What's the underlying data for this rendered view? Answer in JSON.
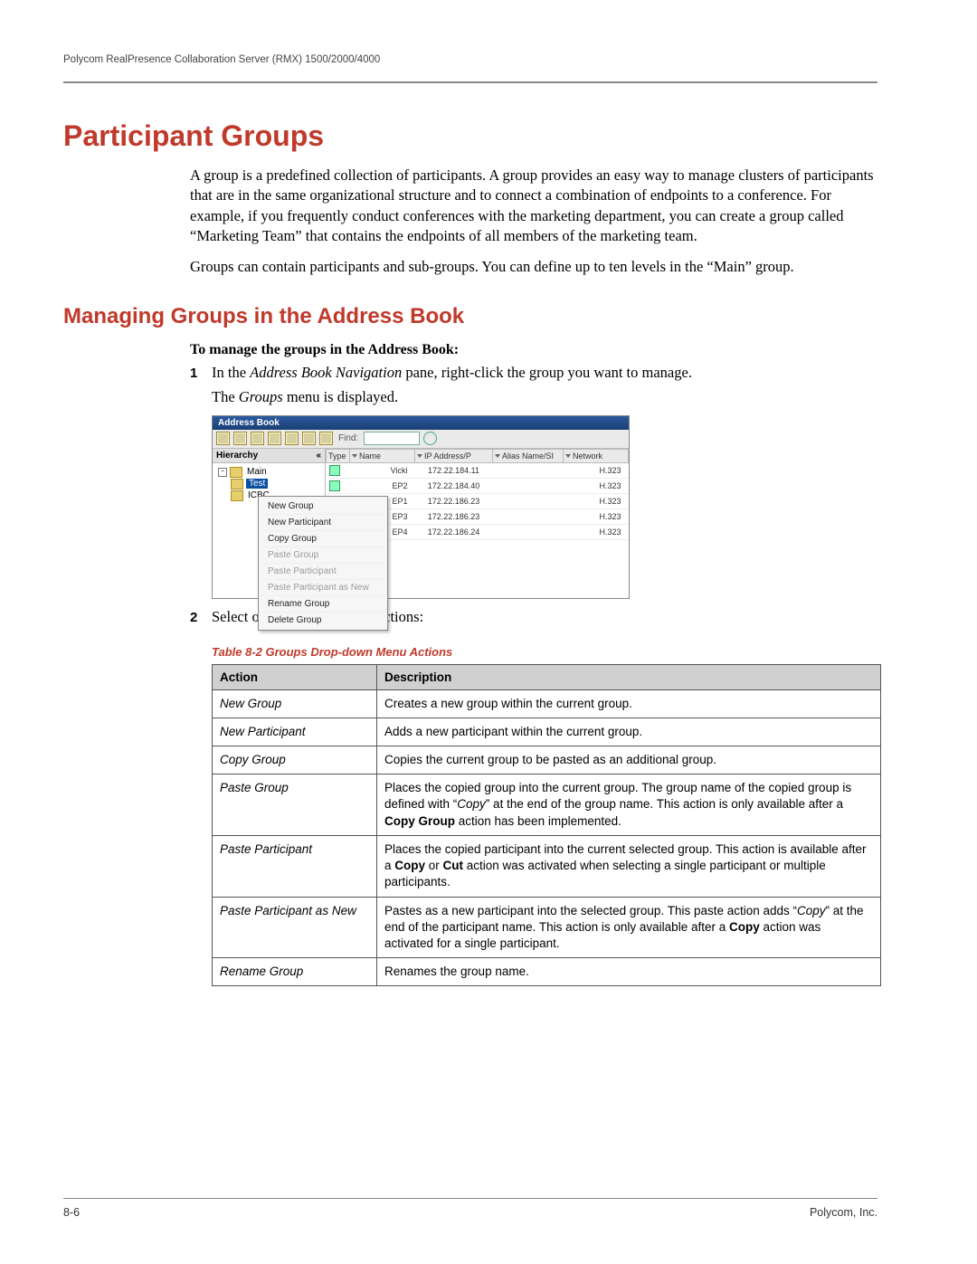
{
  "header": {
    "running": "Polycom RealPresence Collaboration Server (RMX) 1500/2000/4000"
  },
  "h1": "Participant Groups",
  "intro_p1": "A group is a predefined collection of participants. A group provides an easy way to manage clusters of participants that are in the same organizational structure and to connect a combination of endpoints to a conference. For example, if you frequently conduct conferences with the marketing department, you can create a group called “Marketing Team” that contains the endpoints of all members of the marketing team.",
  "intro_p2": "Groups can contain participants and sub-groups. You can define up to ten levels in the “Main” group.",
  "h2": "Managing Groups in the Address Book",
  "lead": "To manage the groups in the Address Book:",
  "step1_a": "In the ",
  "step1_i": "Address Book Navigation",
  "step1_b": " pane, right-click the group you want to manage.",
  "step1_sub_a": "The ",
  "step1_sub_i": "Groups",
  "step1_sub_b": " menu is displayed.",
  "step2": "Select one of the following actions:",
  "shot": {
    "title": "Address Book",
    "find_label": "Find:",
    "hierarchy_header": "Hierarchy",
    "collapse_glyph": "«",
    "tree": {
      "root_symbol": "−",
      "root": "Main",
      "child1": "Test",
      "child2": "ICBC"
    },
    "cols": {
      "type": "Type",
      "name": "Name",
      "ip": "IP Address/P",
      "alias": "Alias Name/SI",
      "network": "Network"
    },
    "rows": [
      {
        "name": "Vicki",
        "ip": "172.22.184.11",
        "net": "H.323"
      },
      {
        "name": "EP2",
        "ip": "172.22.184.40",
        "net": "H.323"
      },
      {
        "name": "EP1",
        "ip": "172.22.186.23",
        "net": "H.323"
      },
      {
        "name": "EP3",
        "ip": "172.22.186.23",
        "net": "H.323"
      },
      {
        "name": "EP4",
        "ip": "172.22.186.24",
        "net": "H.323"
      }
    ],
    "menu": [
      "New Group",
      "New Participant",
      "Copy Group",
      "Paste Group",
      "Paste Participant",
      "Paste Participant as New",
      "Rename Group",
      "Delete Group"
    ]
  },
  "table": {
    "caption": "Table 8-2    Groups Drop-down Menu Actions",
    "head_action": "Action",
    "head_desc": "Description",
    "rows": [
      {
        "action": "New Group",
        "desc": "Creates a new group within the current group."
      },
      {
        "action": "New Participant",
        "desc": "Adds a new participant within the current group."
      },
      {
        "action": "Copy Group",
        "desc": "Copies the current group to be pasted as an additional group."
      },
      {
        "action": "Paste Group",
        "desc_pre": "Places the copied group into the current group. The group name of the copied group is defined with “",
        "desc_i": "Copy",
        "desc_mid": "” at the end of the group name. This action is only available after a ",
        "desc_b": "Copy Group",
        "desc_post": " action has been implemented."
      },
      {
        "action": "Paste Participant",
        "desc_pre": "Places the copied participant into the current selected group. This action is available after a ",
        "desc_b1": "Copy",
        "desc_mid": " or ",
        "desc_b2": "Cut",
        "desc_post": " action was activated when selecting a single participant or multiple participants."
      },
      {
        "action": "Paste Participant as New",
        "desc_pre": "Pastes as a new participant into the selected group. This paste action adds “",
        "desc_i": "Copy",
        "desc_mid": "” at the end of the participant name. This action is only available after a ",
        "desc_b": "Copy",
        "desc_post": " action was activated for a single participant."
      },
      {
        "action": "Rename Group",
        "desc": "Renames the group name."
      }
    ]
  },
  "footer": {
    "left": "8-6",
    "right": "Polycom, Inc."
  }
}
